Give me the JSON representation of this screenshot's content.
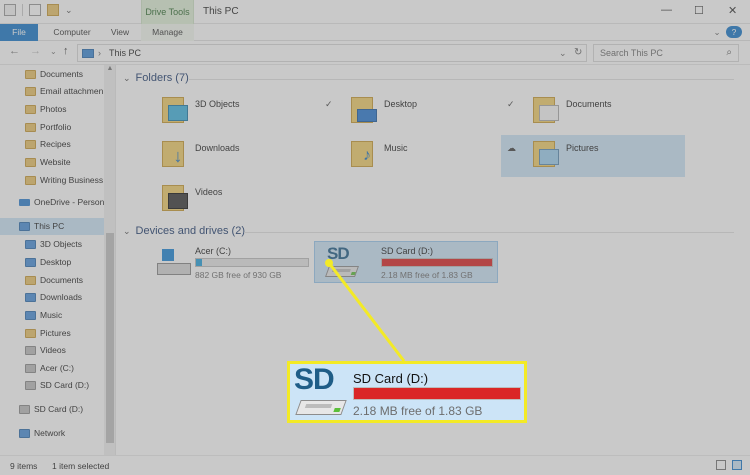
{
  "window": {
    "title": "This PC",
    "context_tab": "Drive Tools",
    "min": "—",
    "max": "☐",
    "close": "✕",
    "help": "?",
    "ribbon_toggle": "⌄"
  },
  "ribbon": {
    "tabs": [
      "File",
      "Computer",
      "View",
      "Manage"
    ]
  },
  "nav": {
    "back": "←",
    "forward": "→",
    "recent": "⌄",
    "up": "↑"
  },
  "address": {
    "path": "This PC",
    "dropdown": "⌄",
    "refresh": "↻"
  },
  "search": {
    "placeholder": "Search This PC",
    "icon": "search-icon"
  },
  "sidebar": {
    "items": [
      {
        "label": "Documents",
        "icon": "folder-icon"
      },
      {
        "label": "Email attachmen",
        "icon": "folder-icon"
      },
      {
        "label": "Photos",
        "icon": "folder-icon"
      },
      {
        "label": "Portfolio",
        "icon": "folder-icon"
      },
      {
        "label": "Recipes",
        "icon": "folder-icon"
      },
      {
        "label": "Website",
        "icon": "folder-icon"
      },
      {
        "label": "Writing Business",
        "icon": "folder-icon"
      },
      {
        "label": "OneDrive - Person",
        "icon": "cloud-icon"
      },
      {
        "label": "This PC",
        "icon": "computer-icon",
        "selected": true
      },
      {
        "label": "3D Objects",
        "icon": "folder-icon"
      },
      {
        "label": "Desktop",
        "icon": "folder-icon"
      },
      {
        "label": "Documents",
        "icon": "folder-icon"
      },
      {
        "label": "Downloads",
        "icon": "folder-icon"
      },
      {
        "label": "Music",
        "icon": "folder-icon"
      },
      {
        "label": "Pictures",
        "icon": "folder-icon"
      },
      {
        "label": "Videos",
        "icon": "folder-icon"
      },
      {
        "label": "Acer (C:)",
        "icon": "drive-icon"
      },
      {
        "label": "SD Card (D:)",
        "icon": "sd-card-icon"
      },
      {
        "label": "SD Card (D:)",
        "icon": "sd-card-icon"
      },
      {
        "label": "Network",
        "icon": "network-icon"
      }
    ]
  },
  "content": {
    "folders_header": "Folders (7)",
    "folders": [
      {
        "name": "3D Objects",
        "status": ""
      },
      {
        "name": "Desktop",
        "status": "✓"
      },
      {
        "name": "Documents",
        "status": "✓"
      },
      {
        "name": "Downloads",
        "status": ""
      },
      {
        "name": "Music",
        "status": ""
      },
      {
        "name": "Pictures",
        "status": "☁",
        "selected": true
      },
      {
        "name": "Videos",
        "status": ""
      }
    ],
    "drives_header": "Devices and drives (2)",
    "drives": [
      {
        "name": "Acer (C:)",
        "free": "882 GB free of 930 GB",
        "used_fraction": 0.05,
        "bar_color": "#26a0da"
      },
      {
        "name": "SD Card (D:)",
        "free": "2.18 MB free of 1.83 GB",
        "used_fraction": 0.999,
        "bar_color": "#da2626",
        "selected": true
      }
    ]
  },
  "zoom_callout": {
    "sd_logo": "SD",
    "name": "SD Card (D:)",
    "free": "2.18 MB free of 1.83 GB",
    "highlight_color": "#f3ea26"
  },
  "statusbar": {
    "items": "9 items",
    "selected": "1 item selected"
  }
}
